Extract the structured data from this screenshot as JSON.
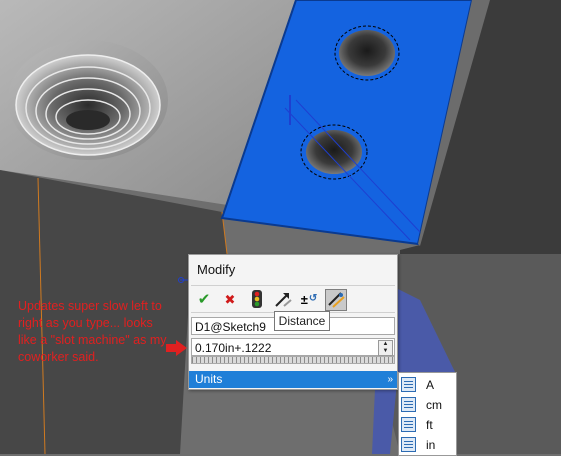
{
  "colors": {
    "accent": "#1f7fd8",
    "face_blue": "#1463e0",
    "annotation": "#e02020"
  },
  "dialog": {
    "title": "Modify",
    "buttons": [
      {
        "icon": "check-icon",
        "glyph": "✔"
      },
      {
        "icon": "close-icon",
        "glyph": "✖"
      },
      {
        "icon": "traffic-light-icon"
      },
      {
        "icon": "arrow-icon"
      },
      {
        "icon": "plus-minus-icon",
        "glyph": "±"
      },
      {
        "icon": "dimension-icon"
      }
    ],
    "name_field": "D1@Sketch9",
    "value_field": "0.170in+.1222",
    "units_label": "Units"
  },
  "tooltip": "Distance",
  "units_menu": [
    "A",
    "cm",
    "ft",
    "in"
  ],
  "annotation": "Updates super slow left to right as you type... looks like a \"slot machine\" as my coworker said."
}
